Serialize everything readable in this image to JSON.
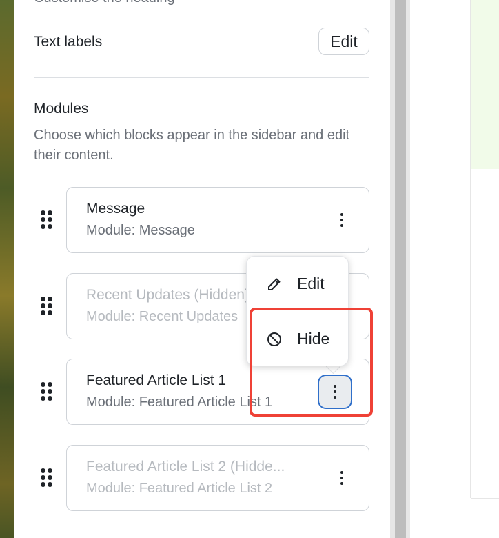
{
  "settings": {
    "cut_off_text": "Customise the heading",
    "text_labels": "Text labels",
    "edit_button": "Edit",
    "modules_title": "Modules",
    "modules_description": "Choose which blocks appear in the sidebar and edit their content."
  },
  "modules": [
    {
      "title": "Message",
      "subtitle": "Module: Message",
      "hidden": false
    },
    {
      "title": "Recent Updates (Hidden)",
      "subtitle": "Module: Recent Updates",
      "hidden": true
    },
    {
      "title": "Featured Article List 1",
      "subtitle": "Module: Featured Article List 1",
      "hidden": false
    },
    {
      "title": "Featured Article List 2 (Hidde...",
      "subtitle": "Module: Featured Article List 2",
      "hidden": true
    }
  ],
  "context_menu": {
    "items": [
      {
        "label": "Edit",
        "icon": "pencil-icon"
      },
      {
        "label": "Hide",
        "icon": "hide-circle-slash-icon"
      }
    ]
  },
  "colors": {
    "highlight": "#ef4136",
    "focus_ring": "#2f6fca"
  }
}
